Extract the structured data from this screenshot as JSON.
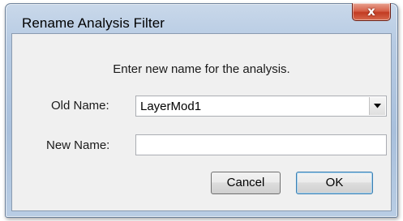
{
  "window": {
    "title": "Rename Analysis Filter",
    "close_glyph": "x"
  },
  "dialog": {
    "prompt": "Enter new name for the analysis.",
    "old_name_label": "Old Name:",
    "old_name_value": "LayerMod1",
    "new_name_label": "New Name:",
    "new_name_value": "",
    "cancel_label": "Cancel",
    "ok_label": "OK"
  },
  "colors": {
    "close_button": "#c94a30",
    "frame": "#b7cbe3",
    "client": "#f0f0f0"
  }
}
